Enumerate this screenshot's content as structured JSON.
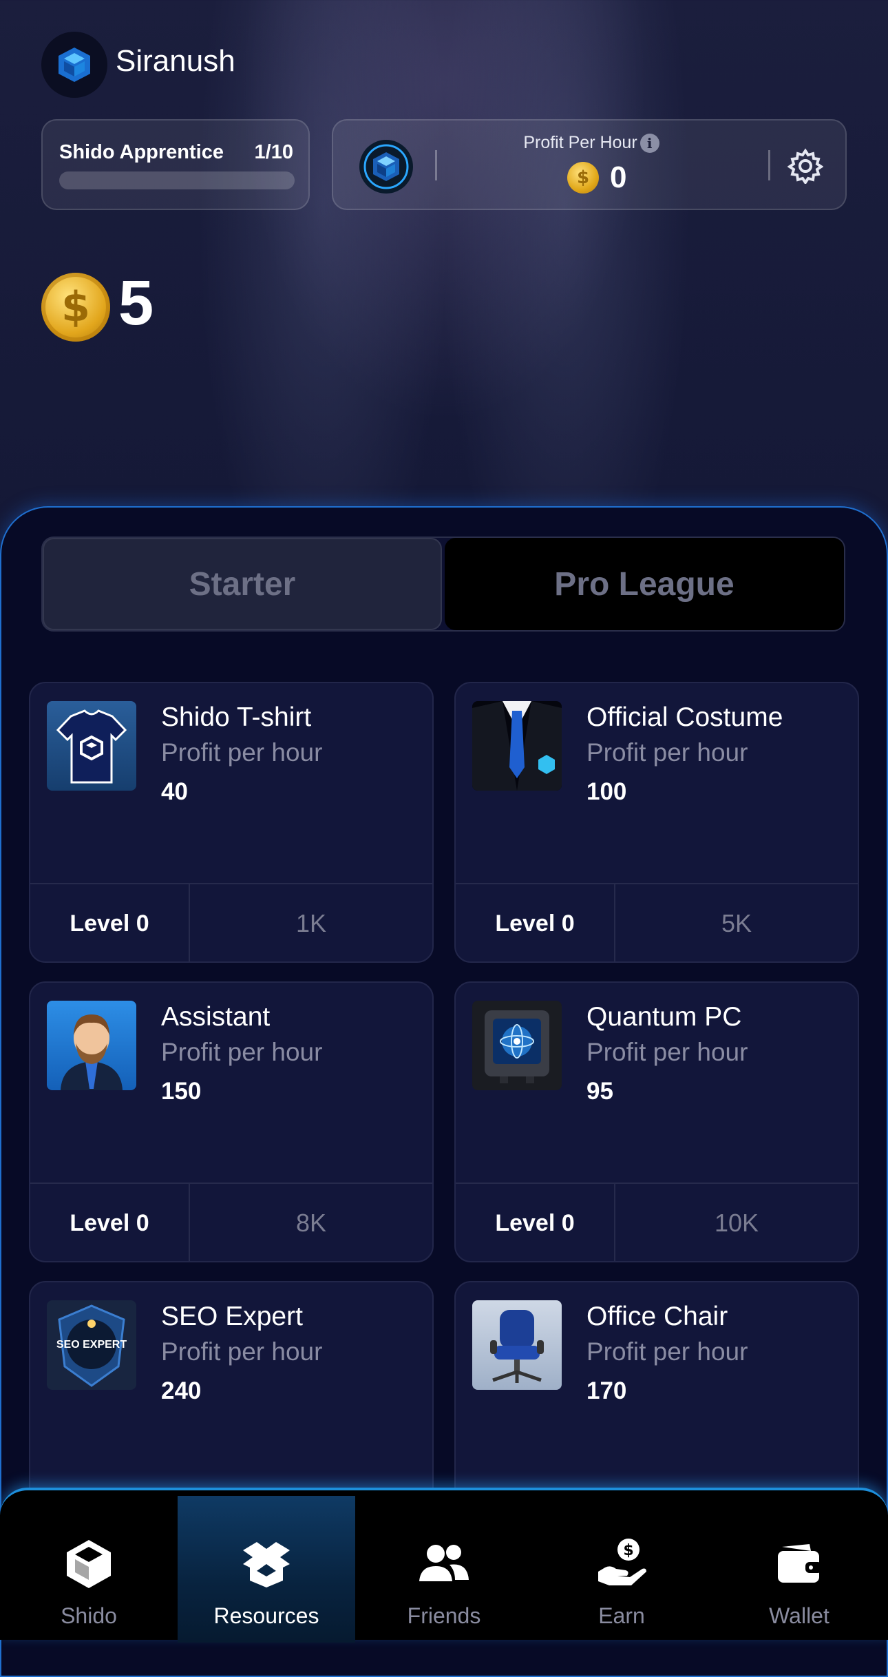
{
  "header": {
    "username": "Siranush",
    "rank": {
      "title": "Shido Apprentice",
      "count": "1/10",
      "progress": 0
    },
    "profit_per_hour": {
      "label": "Profit Per Hour",
      "value": "0"
    }
  },
  "balance": "5",
  "tabs": [
    {
      "label": "Starter",
      "active": true
    },
    {
      "label": "Pro League",
      "active": false
    }
  ],
  "cards": [
    {
      "title": "Shido T-shirt",
      "sub": "Profit per hour",
      "value": "40",
      "level": "Level 0",
      "cost": "1K",
      "icon": "tshirt-icon"
    },
    {
      "title": "Official Costume",
      "sub": "Profit per hour",
      "value": "100",
      "level": "Level 0",
      "cost": "5K",
      "icon": "suit-icon"
    },
    {
      "title": "Assistant",
      "sub": "Profit per hour",
      "value": "150",
      "level": "Level 0",
      "cost": "8K",
      "icon": "assistant-icon"
    },
    {
      "title": "Quantum PC",
      "sub": "Profit per hour",
      "value": "95",
      "level": "Level 0",
      "cost": "10K",
      "icon": "quantum-pc-icon"
    },
    {
      "title": "SEO Expert",
      "sub": "Profit per hour",
      "value": "240",
      "level": "",
      "cost": "",
      "icon": "seo-badge-icon",
      "badge_text": "SEO EXPERT"
    },
    {
      "title": "Office Chair",
      "sub": "Profit per hour",
      "value": "170",
      "level": "",
      "cost": "",
      "icon": "office-chair-icon"
    }
  ],
  "nav": [
    {
      "label": "Shido",
      "icon": "shido-logo-icon",
      "active": false
    },
    {
      "label": "Resources",
      "icon": "box-icon",
      "active": true
    },
    {
      "label": "Friends",
      "icon": "friends-icon",
      "active": false
    },
    {
      "label": "Earn",
      "icon": "earn-icon",
      "active": false
    },
    {
      "label": "Wallet",
      "icon": "wallet-icon",
      "active": false
    }
  ],
  "colors": {
    "accent": "#1d8fdc",
    "panel_bg": "#070a26",
    "card_bg": "#12163a",
    "coin": "#e2a61c"
  }
}
